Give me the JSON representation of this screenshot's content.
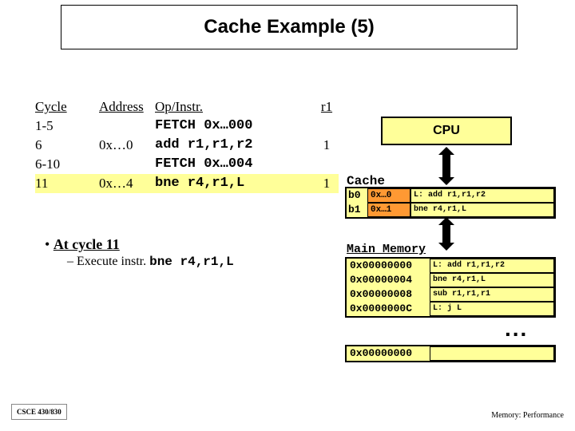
{
  "title": "Cache Example (5)",
  "trace": {
    "header": {
      "cycle": "Cycle",
      "addr": "Address",
      "op": "Op/Instr.",
      "r1": "r1"
    },
    "rows": [
      {
        "cycle": "1-5",
        "addr": "",
        "op": "FETCH 0x…000",
        "r1": "",
        "hl": false
      },
      {
        "cycle": "6",
        "addr": "0x…0",
        "op": "add r1,r1,r2",
        "r1": "1",
        "hl": false
      },
      {
        "cycle": "6-10",
        "addr": "",
        "op": "FETCH 0x…004",
        "r1": "",
        "hl": false
      },
      {
        "cycle": "11",
        "addr": "0x…4",
        "op": "bne r4,r1,L",
        "r1": "1",
        "hl": true
      }
    ]
  },
  "bullet": {
    "main": "At cycle 11",
    "sub_prefix": "Execute instr. ",
    "sub_code": "bne r4,r1,L"
  },
  "cpu_label": "CPU",
  "cache": {
    "label": "Cache",
    "rows": [
      {
        "tag": "b0",
        "addr": "0x…0",
        "inst": "L: add r1,r1,r2"
      },
      {
        "tag": "b1",
        "addr": "0x…1",
        "inst": "   bne r4,r1,L"
      }
    ]
  },
  "mem": {
    "label": "Main Memory",
    "rows": [
      {
        "addr": "0x00000000",
        "inst": "L: add r1,r1,r2"
      },
      {
        "addr": "0x00000004",
        "inst": "   bne r4,r1,L"
      },
      {
        "addr": "0x00000008",
        "inst": "   sub r1,r1,r1"
      },
      {
        "addr": "0x0000000C",
        "inst": "L: j L"
      }
    ],
    "dots": "...",
    "extra": {
      "addr": "0x00000000",
      "inst": ""
    }
  },
  "footer": {
    "left": "CSCE 430/830",
    "right": "Memory: Performance"
  }
}
